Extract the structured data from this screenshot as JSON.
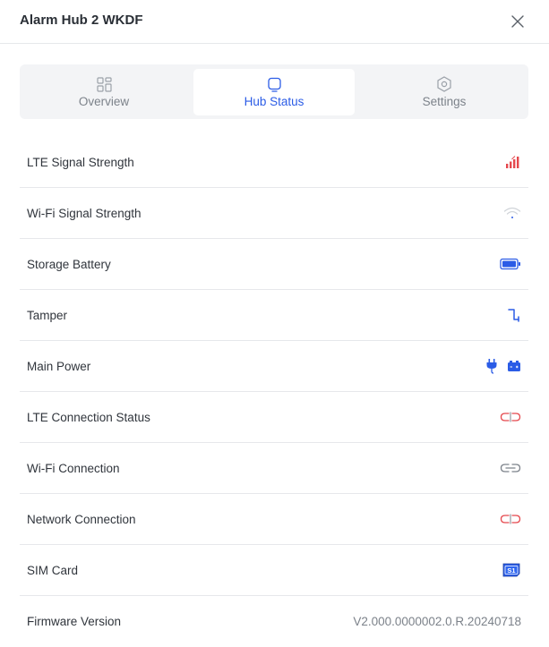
{
  "header": {
    "title": "Alarm Hub 2 WKDF",
    "close_icon": "close-icon"
  },
  "tabs": [
    {
      "label": "Overview",
      "icon": "grid-icon",
      "active": false
    },
    {
      "label": "Hub Status",
      "icon": "hub-status-icon",
      "active": true
    },
    {
      "label": "Settings",
      "icon": "settings-hexagon-icon",
      "active": false
    }
  ],
  "status": {
    "rows": [
      {
        "label": "LTE Signal Strength",
        "icon": "signal-bars-icon",
        "color": "#e5484d"
      },
      {
        "label": "Wi-Fi Signal Strength",
        "icon": "wifi-icon",
        "color": "#c9cdd3"
      },
      {
        "label": "Storage Battery",
        "icon": "battery-icon",
        "color": "#2b5ce6"
      },
      {
        "label": "Tamper",
        "icon": "tamper-icon",
        "color": "#2b5ce6"
      },
      {
        "label": "Main Power",
        "icons": [
          "plug-icon",
          "battery-pack-icon"
        ],
        "color": "#2b5ce6"
      },
      {
        "label": "LTE Connection Status",
        "icon": "link-broken-icon",
        "color": "#e5484d"
      },
      {
        "label": "Wi-Fi Connection",
        "icon": "link-icon",
        "color": "#7c828a"
      },
      {
        "label": "Network Connection",
        "icon": "link-broken-icon",
        "color": "#e5484d"
      },
      {
        "label": "SIM Card",
        "icon": "sim-card-icon",
        "badge": "S1",
        "color": "#2b5ce6"
      },
      {
        "label": "Firmware Version",
        "value": "V2.000.0000002.0.R.20240718"
      }
    ]
  },
  "colors": {
    "accent": "#2b5ce6",
    "error": "#e5484d",
    "muted": "#7c828a"
  }
}
